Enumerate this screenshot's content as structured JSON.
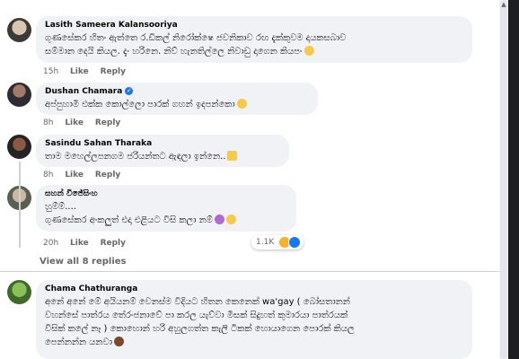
{
  "comments": [
    {
      "author": "Lasith Sameera Kalansooriya",
      "lines": [
        "ගුණසේකර හිතං ඇත්තෙ ර.ඩිකල් නිරෝක්ෂෙ ජවනිකාව රඟ දැක්කුවම දායකසබාව",
        "සම්මාන දෙයි කියල. දැං හරිනෙ. නිව් හැනතිල්ලෙ නිවාඩු දාගෙන කියපං"
      ],
      "time": "15h",
      "like": "Like",
      "reply": "Reply"
    },
    {
      "author": "Dushan Chamara",
      "lines": [
        "අප්පුහාමි එක්ක කොල්ලො පාරක් ගහන් ඉදපන්කො"
      ],
      "time": "8h",
      "like": "Like",
      "reply": "Reply"
    },
    {
      "author": "Sasindu Sahan Tharaka",
      "lines": [
        "තාම මහෙල්ලපනගම ජරියන්තට ඇඳලා ඉන්නෙ.."
      ],
      "time": "8h",
      "like": "Like",
      "reply": "Reply"
    },
    {
      "author": "සහන් විජේසිංහ",
      "lines": [
        "හුම්ම්....",
        "ගුණසේකර අංකලුත් එදා එළියට විසි කලා නම්"
      ],
      "time": "20h",
      "like": "Like",
      "reply": "Reply",
      "reaction_count": "1.1K"
    },
    {
      "author": "Chama Chathuranga",
      "lines": [
        "අනේ අනේ මේ අයියනම් වෙනස්ම විදියට හිතන කෙනෙක් wa'gay ( බෝසතානන්",
        "වහන්සේ පාත්රය තේරංජනාවේ පා කරල යැව්වා මිසක් සිදුහත් කුමාරයා පාත්රයක්",
        "විසික් කලේ නෑ ) කොහොන් හරි අහුලගත්ත කැලි ටිකක් හොයාගෙන පොරක් කියල",
        "පෙන්නන්න යනවා"
      ],
      "time": "",
      "like": "",
      "reply": ""
    }
  ],
  "view_all_replies": "View all 8 replies",
  "colors": {
    "bubble": "#f0f2f5",
    "meta": "#65676b",
    "verified": "#1877f2",
    "like_reaction": "#1877f2",
    "haha_reaction": "#f7b125"
  },
  "icons": [
    "verified-badge-icon",
    "emoji-icon",
    "haha-reaction-icon",
    "like-reaction-icon"
  ]
}
